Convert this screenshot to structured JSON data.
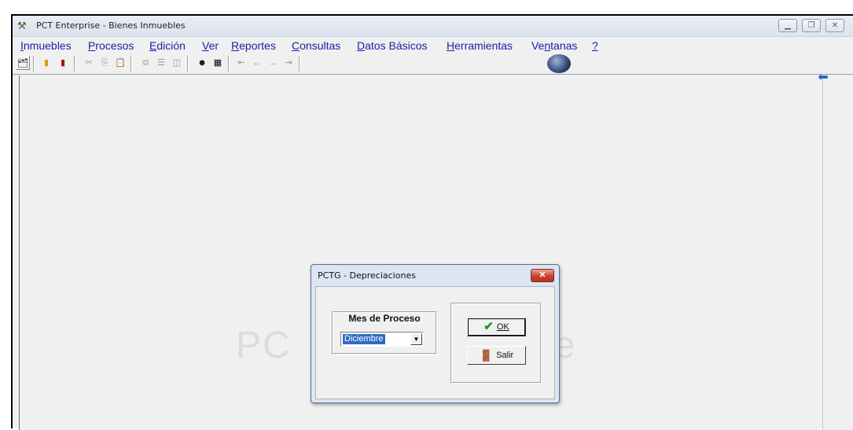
{
  "window": {
    "title": "PCT Enterprise - Bienes Inmuebles",
    "icon": "hammer-icon"
  },
  "menu": [
    {
      "label": "Inmuebles",
      "accel": "I"
    },
    {
      "label": "Procesos",
      "accel": "P"
    },
    {
      "label": "Edición",
      "accel": "E"
    },
    {
      "label": "Ver",
      "accel": "V"
    },
    {
      "label": "Reportes",
      "accel": "R"
    },
    {
      "label": "Consultas",
      "accel": "C"
    },
    {
      "label": "Datos Básicos",
      "accel": "D"
    },
    {
      "label": "Herramientas",
      "accel": "H"
    },
    {
      "label": "Ventanas",
      "accel": "n"
    },
    {
      "label": "?",
      "accel": "?"
    }
  ],
  "toolbar": {
    "icons": [
      "open-icon",
      "book-icon",
      "exit-door-icon",
      "cut-icon",
      "copy-icon",
      "paste-icon",
      "cascade-icon",
      "tile-horizontal-icon",
      "tile-vertical-icon",
      "user-icon",
      "calculator-icon",
      "first-icon",
      "previous-icon",
      "next-icon",
      "last-icon"
    ]
  },
  "watermark": {
    "left": "PC",
    "right": "e"
  },
  "dialog": {
    "title": "PCTG - Depreciaciones",
    "close": "✕",
    "month_label": "Mes de Proceso",
    "month_value": "Diciembre",
    "ok_label": "OK",
    "exit_label": "Salir"
  }
}
